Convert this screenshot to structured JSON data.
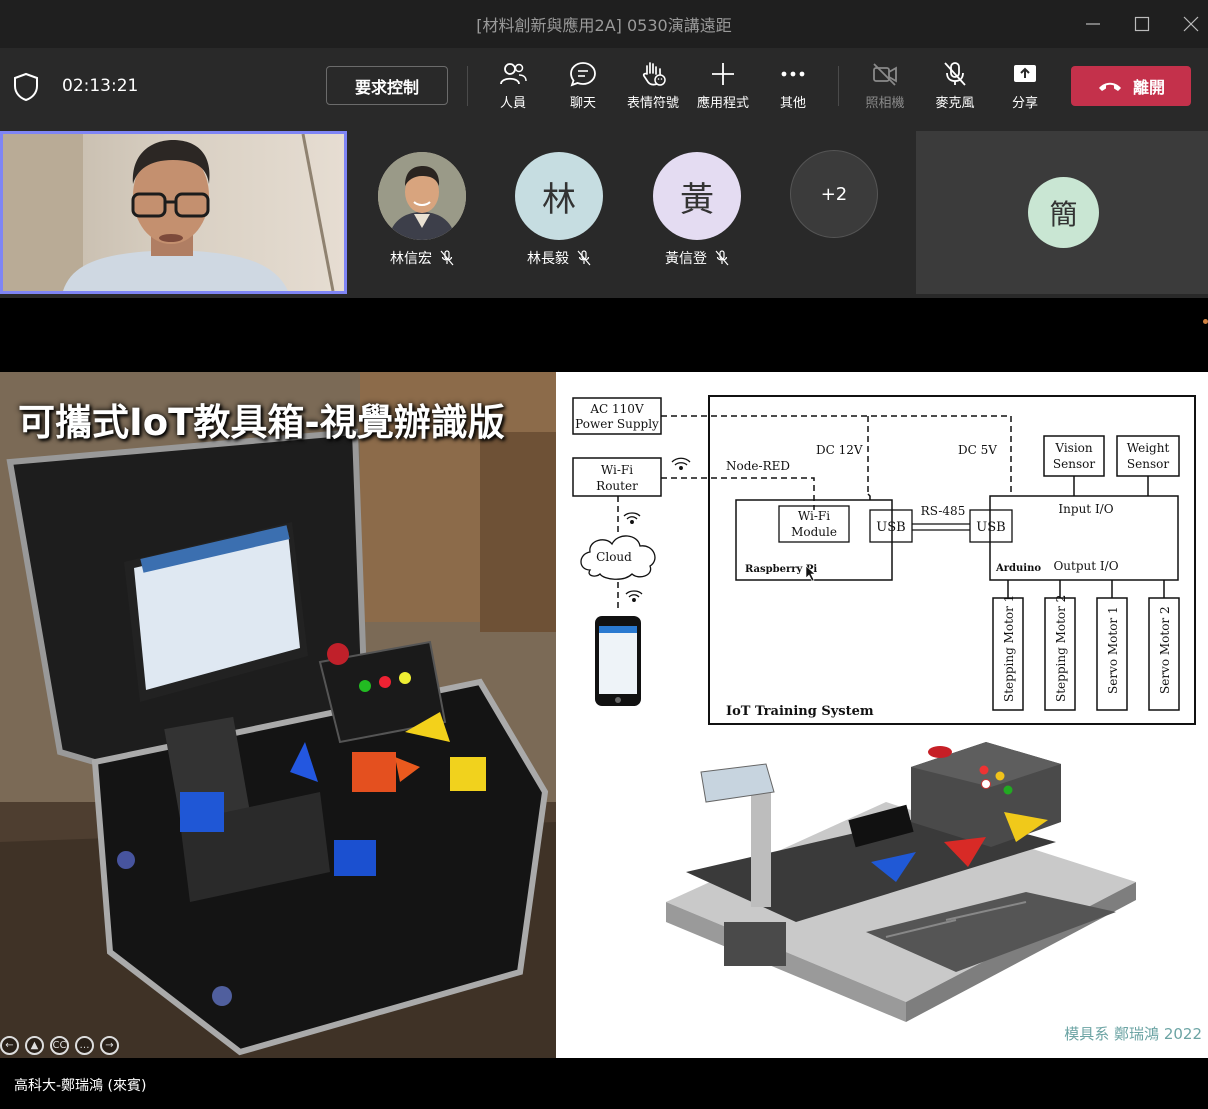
{
  "window": {
    "title": "[材料創新與應用2A] 0530演講遠距"
  },
  "toolbar": {
    "timer": "02:13:21",
    "request_control_label": "要求控制",
    "people_label": "人員",
    "chat_label": "聊天",
    "reactions_label": "表情符號",
    "apps_label": "應用程式",
    "more_label": "其他",
    "camera_label": "照相機",
    "mic_label": "麥克風",
    "share_label": "分享",
    "leave_label": "離開"
  },
  "participants": [
    {
      "name": "林信宏",
      "initial": "",
      "muted": true
    },
    {
      "name": "林長毅",
      "initial": "林",
      "muted": true,
      "color": "#c6dde1"
    },
    {
      "name": "黃信登",
      "initial": "黃",
      "muted": true,
      "color": "#e4dcf2"
    }
  ],
  "overflow_count": "+2",
  "big_tile": {
    "initial": "簡",
    "color": "#c9e6d3"
  },
  "slide": {
    "title": "可攜式IoT教具箱-視覺辦識版",
    "credit": "模具系 鄭瑞鴻 2022",
    "diagram": {
      "ac_power": [
        "AC 110V",
        "Power Supply"
      ],
      "wifi_router": [
        "Wi-Fi",
        "Router"
      ],
      "node_red": "Node-RED",
      "cloud": "Cloud",
      "dc12": "DC 12V",
      "dc5": "DC 5V",
      "vision_sensor": [
        "Vision",
        "Sensor"
      ],
      "weight_sensor": [
        "Weight",
        "Sensor"
      ],
      "wifi_module": [
        "Wi-Fi",
        "Module"
      ],
      "usb_left": "USB",
      "usb_right": "USB",
      "rs485": "RS-485",
      "input_io": "Input I/O",
      "output_io": "Output I/O",
      "raspberry_pi": "Raspberry Pi",
      "arduino": "Arduino",
      "motors": [
        "Stepping Motor 1",
        "Stepping Motor 2",
        "Servo Motor 1",
        "Servo Motor 2"
      ],
      "system_label": "IoT Training System"
    }
  },
  "presenter_label": "高科大-鄭瑞鴻 (來賓)",
  "colors": {
    "accent": "#7f85f5",
    "leave": "#c4314b",
    "toolbar": "#292929",
    "titlebar": "#1f1f1f"
  }
}
